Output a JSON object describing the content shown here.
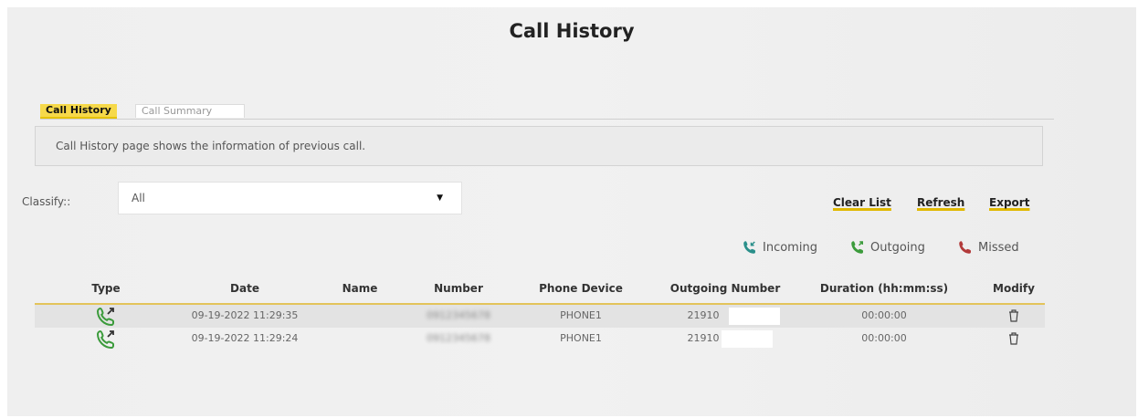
{
  "page": {
    "title": "Call History"
  },
  "tabs": [
    {
      "label": "Call History",
      "active": true
    },
    {
      "label": "Call Summary",
      "active": false
    }
  ],
  "info": {
    "text": "Call History page shows the information of previous call."
  },
  "filter": {
    "label": "Classify::",
    "selected": "All"
  },
  "actions": {
    "clear_list": "Clear List",
    "refresh": "Refresh",
    "export": "Export"
  },
  "legend": {
    "incoming": "Incoming",
    "outgoing": "Outgoing",
    "missed": "Missed",
    "colors": {
      "incoming": "#2a8f8a",
      "outgoing": "#3b9b3b",
      "missed": "#b23a3a",
      "accent": "#f6d94a"
    }
  },
  "table": {
    "headers": [
      "Type",
      "Date",
      "Name",
      "Number",
      "Phone Device",
      "Outgoing Number",
      "Duration (hh:mm:ss)",
      "Modify"
    ],
    "rows": [
      {
        "type": "outgoing-call-icon",
        "date": "09-19-2022 11:29:35",
        "name": "",
        "number": "0912345678",
        "device": "PHONE1",
        "outgoing": "21910",
        "duration": "00:00:00"
      },
      {
        "type": "outgoing-call-icon",
        "date": "09-19-2022 11:29:24",
        "name": "",
        "number": "0912345678",
        "device": "PHONE1",
        "outgoing": "21910",
        "duration": "00:00:00"
      }
    ]
  }
}
